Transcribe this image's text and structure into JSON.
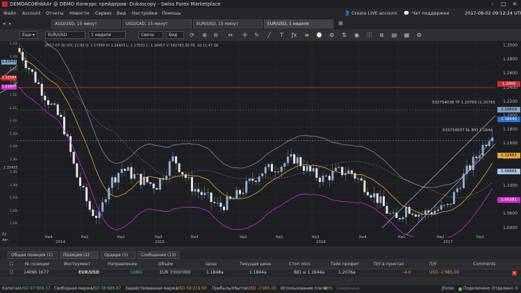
{
  "window": {
    "title": "DEMOAC08hbkAr @ DEMO Конкурс трейдеров- Dukascopy - Swiss Forex Marketplace"
  },
  "menu": {
    "items": [
      "Файл",
      "Account",
      "Отчеты",
      "Новости",
      "Сервис",
      "Вид",
      "Настройки",
      "Помощь"
    ],
    "create_live": "Create LIVE account",
    "chat": "Чат поддержки",
    "datetime": "2017-08-02 09:12:24 UTC"
  },
  "tabs": [
    {
      "label": "AUD/USD, 15 минут"
    },
    {
      "label": "USD/CAD, 15 минут"
    },
    {
      "label": "EUR/USD, 15 минут"
    },
    {
      "label": "EUR/USD, 1 неделя"
    }
  ],
  "toolbar": {
    "more": "Еще",
    "instrument": "EUR/USD",
    "period": "1 неделя",
    "chart_type": "Свеча",
    "view": "Вид"
  },
  "chart_info": {
    "ohlc": "2017-07-30 UTC 21:00 O: 1.17459 H: 1.18403 L: 1.17031 C: 1.18457 V: 592763.30 TR: 2d 11:47:36",
    "tp_label": "533754038 TP 1.20765 (1.20765)",
    "sl_label": "533754037 SL BID 1.1644"
  },
  "price_axis": {
    "ticks": [
      "1.3000",
      "1.2800",
      "1.2600",
      "1.2400",
      "1.2200",
      "1.2000",
      "1.1800",
      "1.1600",
      "1.1400",
      "1.1200",
      "1.1000",
      "1.0800",
      "1.0600",
      "1.0400"
    ],
    "boxes": [
      {
        "text": "1.2400",
        "color": "#d42a2a"
      },
      {
        "text": "1.19619",
        "color": "#7fa4c8"
      },
      {
        "text": "1.18440",
        "color": "#2a6fd4"
      },
      {
        "text": "1.12881",
        "color": "#e8a830"
      },
      {
        "text": "1.09665",
        "color": "#a9c4e4"
      },
      {
        "text": "1.05281",
        "color": "#d42ad4"
      }
    ]
  },
  "left_panel": {
    "ticks": [
      "1.3360",
      "1.3200",
      "1.3180",
      "1.3160",
      "1.3140",
      "1.3120",
      "1.3100",
      "1.3080",
      "1.3060",
      "1.3040",
      "1.3020",
      "1.3000",
      "1.2980",
      "1.2960",
      "1.2940"
    ],
    "boxes": [
      {
        "text": "1.32584",
        "color": "#d42a2a"
      },
      {
        "text": "1.31807",
        "color": "#d42ad4"
      },
      {
        "text": "1.32643",
        "color": "#7fa4c8"
      }
    ],
    "side_label": "1.30455"
  },
  "time_axis": {
    "labels": [
      "Кв4",
      "Кв1",
      "Кв2",
      "Кв3",
      "Кв4",
      "Кв1",
      "Кв2",
      "Кв3",
      "Кв4",
      "Кв1",
      "Кв2",
      "Кв3",
      "Кв4",
      "Кв1",
      "Кв2",
      "Кв3"
    ],
    "years": [
      "2014",
      "2015",
      "2016",
      "2017"
    ]
  },
  "bottom_tabs": [
    {
      "label": "Общая позиция (1)"
    },
    {
      "label": "Позиции (1)"
    },
    {
      "label": "Ордера (5)"
    },
    {
      "label": "Сообщения (13)"
    }
  ],
  "table": {
    "headers": [
      "№ позиции",
      "Инструмент",
      "Направление",
      "Объём",
      "Цена",
      "Текущая цена",
      "Стоп лосс",
      "Тейк профит",
      "П/У в пунктах",
      "П/У",
      "Comments"
    ],
    "row": {
      "id": "14096 1677",
      "instrument": "EUR/USD",
      "direction": "LONG",
      "volume": "EUR 3'000'000",
      "price": "1.1848a",
      "current": "1.1844a",
      "stop": "BID ≤ 1.1644a",
      "take": "1.2076a",
      "pips": "-4.0",
      "pl": "USD -1'985.00"
    }
  },
  "statusbar": {
    "capital_label": "Капитал:",
    "capital": "USD 97'908.37",
    "free_margin_label": "Свободная маржа:",
    "free_margin": "USD 38'688.87",
    "used_margin_label": "Задействованная маржа:",
    "used_margin": "USD 59'219.50",
    "pl_label": "Прибыль/Убыток:",
    "pl": "USD -1'985.00",
    "margin_usage_label": "Использование плеча:",
    "margin_usage": "60%",
    "connection": "Соединено",
    "jforex": "JForex",
    "unsubscribed": "Подключено",
    "detached": "Отделено: 0"
  },
  "colors": {
    "bull_candle": "#8fb0d8",
    "bear_candle": "#e8e8ea",
    "bb_upper": "#7e8fa8",
    "bb_mid": "#e8a830",
    "bb_lower": "#d42ad4",
    "resistance": "#d42a2a"
  },
  "icons": [
    "dukascopy-logo-icon",
    "minimize-icon",
    "maximize-icon",
    "close-icon",
    "refresh-icon",
    "zoom-in-icon",
    "zoom-out-icon",
    "crosshair-icon",
    "pencil-icon",
    "indicator-icon",
    "settings-icon",
    "help-icon"
  ]
}
